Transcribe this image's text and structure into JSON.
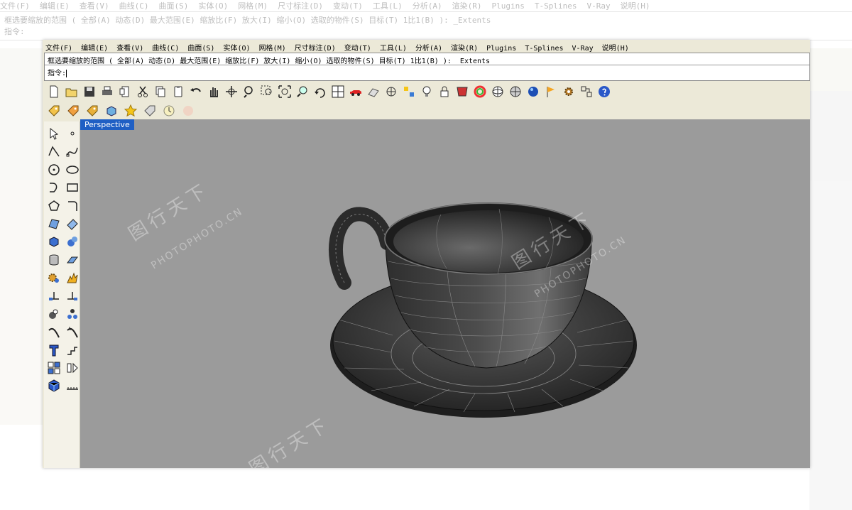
{
  "menu": {
    "items": [
      "文件(F)",
      "编辑(E)",
      "查看(V)",
      "曲线(C)",
      "曲面(S)",
      "实体(O)",
      "网格(M)",
      "尺寸标注(D)",
      "变动(T)",
      "工具(L)",
      "分析(A)",
      "渲染(R)",
      "Plugins",
      "T-Splines",
      "V-Ray",
      "说明(H)"
    ]
  },
  "command": {
    "prompt_line": "框选要缩放的范围 ( 全部(A)  动态(D)  最大范围(E)  缩放比(F)  放大(I)  缩小(O)  选取的物件(S)  目标(T)  1比1(B) ): _Extents",
    "input_label": "指令:"
  },
  "toolbar_main": [
    "new-icon",
    "open-icon",
    "save-icon",
    "print-icon",
    "import-icon",
    "cut-icon",
    "copy-icon",
    "paste-icon",
    "undo-icon",
    "pan-hand-icon",
    "rotate-view-icon",
    "zoom-icon",
    "zoom-window-icon",
    "zoom-extents-icon",
    "zoom-selected-icon",
    "undo-view-icon",
    "four-viewports-icon",
    "car-icon",
    "grid-icon",
    "target-icon",
    "snap-icon",
    "light-bulb-icon",
    "lock-icon",
    "material-icon",
    "color-wheel-icon",
    "sphere-wire-icon",
    "render-globe-icon",
    "blue-sphere-icon",
    "flag-icon",
    "gear-icon",
    "dimension-icon",
    "help-icon"
  ],
  "toolbar_secondary": [
    "tag-yellow-icon",
    "tag-orange-icon",
    "tag-amber-icon",
    "box-blue-icon",
    "star-icon",
    "tag-gray-icon",
    "clock-icon",
    "vray-icon"
  ],
  "sidebar": [
    "select-arrow-icon",
    "point-icon",
    "polyline-icon",
    "curve-points-icon",
    "circle-icon",
    "ellipse-icon",
    "arc-icon",
    "rectangle-icon",
    "polygon-icon",
    "fillet-icon",
    "surface-icon",
    "surface-edit-icon",
    "box-solid-icon",
    "sphere-solid-icon",
    "cylinder-icon",
    "extrude-icon",
    "puzzle-icon",
    "explode-icon",
    "split-icon",
    "trim-icon",
    "boolean-icon",
    "array-icon",
    "curve-blend-icon",
    "offset-icon",
    "text-icon",
    "dimension-step-icon",
    "group-icon",
    "layer-icon",
    "cube-blue-icon",
    "ruler-icon"
  ],
  "viewport": {
    "label": "Perspective"
  },
  "watermark": {
    "brand": "图行天下",
    "site": "PHOTOPHOTO.CN"
  },
  "colors": {
    "window_bg": "#ece9d8",
    "viewport_bg": "#9b9b9b",
    "tab_bg": "#1f5fc4"
  }
}
